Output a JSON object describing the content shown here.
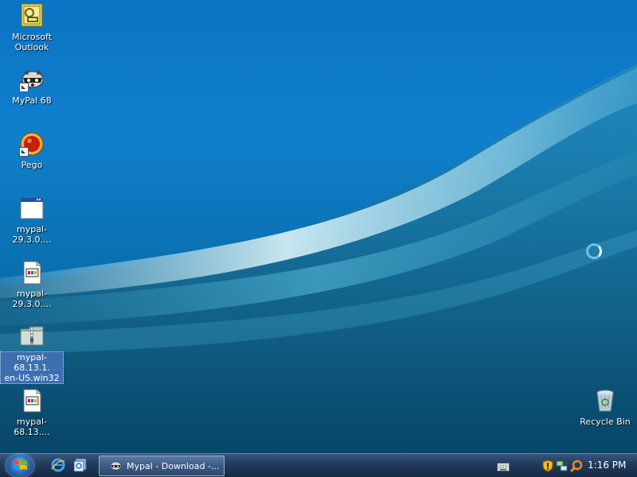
{
  "desktop": {
    "icons": [
      {
        "label": "Microsoft\nOutlook",
        "icon": "outlook-icon"
      },
      {
        "label": "MyPal 68",
        "icon": "mypal-raccoon-icon"
      },
      {
        "label": "Pego",
        "icon": "pego-icon"
      },
      {
        "label": "mypal-29.3.0....",
        "icon": "window-exe-icon"
      },
      {
        "label": "mypal-29.3.0....",
        "icon": "installer-icon"
      },
      {
        "label": "mypal-68.13.1.\nen-US.win32",
        "icon": "zip-folder-icon"
      },
      {
        "label": "mypal-68.13....",
        "icon": "installer-icon"
      },
      {
        "label": "Recycle Bin",
        "icon": "recycle-bin-icon"
      }
    ]
  },
  "taskbar": {
    "task_label": "Mypal - Download -...",
    "clock": "1:16 PM"
  },
  "colors": {
    "desktop_top": "#0b74c4",
    "desktop_bottom": "#0a4f73",
    "taskbar": "#223a5c",
    "selection": "#3d6fb0"
  }
}
